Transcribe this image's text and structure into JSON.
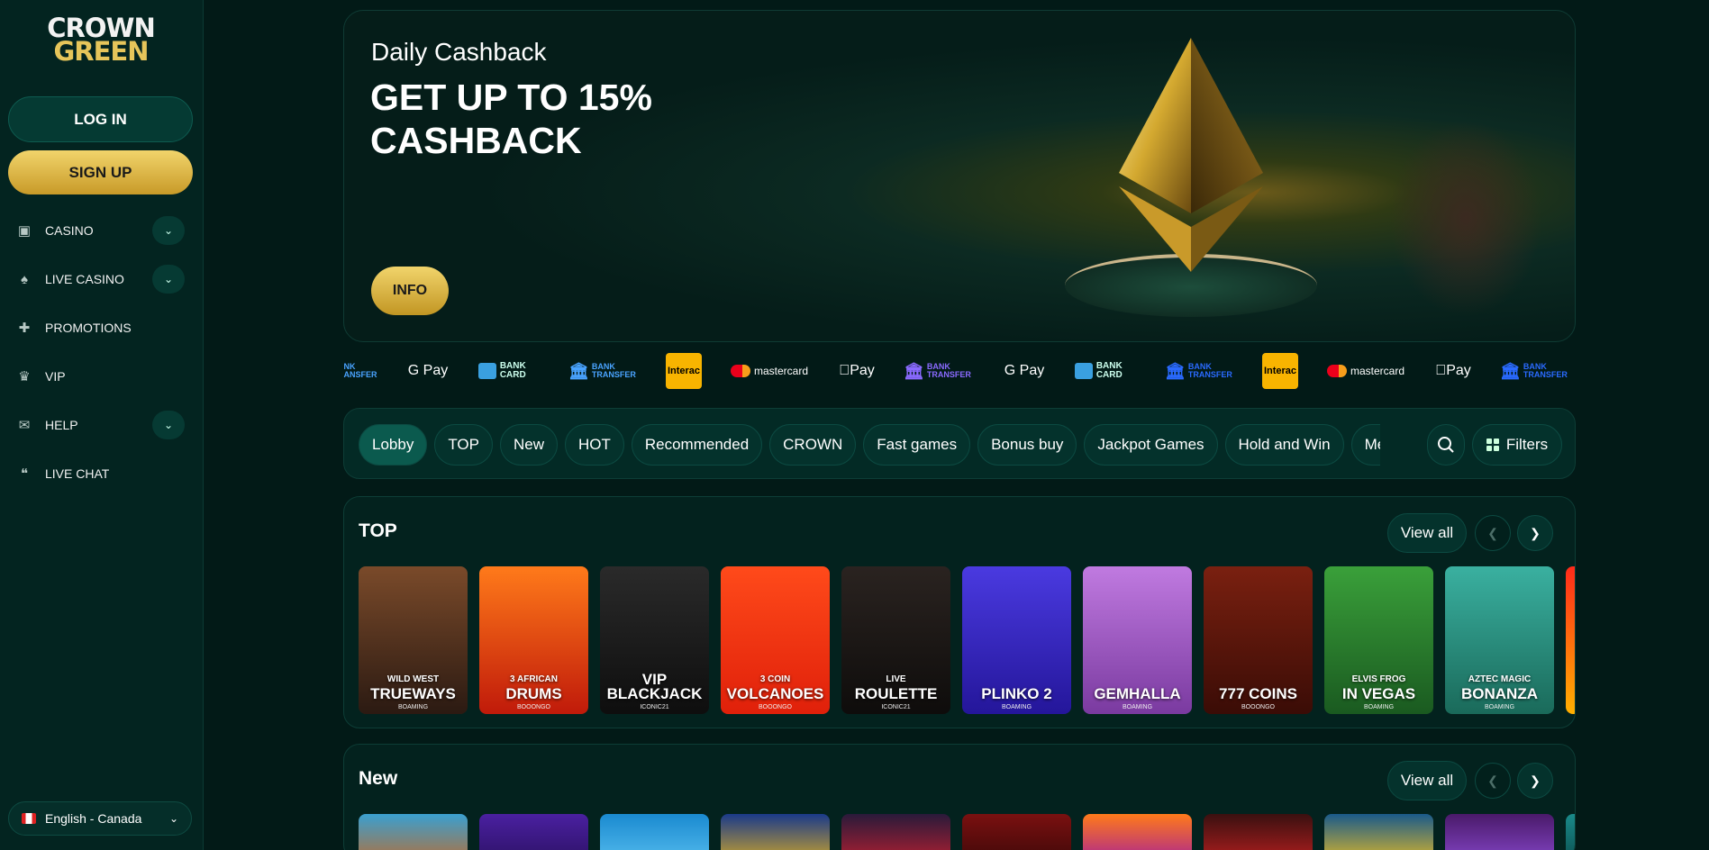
{
  "brand": {
    "line1": "CROWN",
    "line2": "GREEN"
  },
  "auth": {
    "login": "LOG IN",
    "signup": "SIGN UP"
  },
  "nav": [
    {
      "label": "CASINO",
      "icon": "casino-icon",
      "has_chevron": true
    },
    {
      "label": "LIVE CASINO",
      "icon": "spade-icon",
      "has_chevron": true
    },
    {
      "label": "PROMOTIONS",
      "icon": "gift-icon",
      "has_chevron": false
    },
    {
      "label": "VIP",
      "icon": "crown-icon",
      "has_chevron": false
    },
    {
      "label": "HELP",
      "icon": "mail-icon",
      "has_chevron": true
    },
    {
      "label": "LIVE CHAT",
      "icon": "chat-icon",
      "has_chevron": false
    }
  ],
  "language": {
    "label": "English - Canada",
    "flag": "canada-flag-icon"
  },
  "hero": {
    "subtitle": "Daily Cashback",
    "title": "GET UP TO 15% CASHBACK",
    "button": "INFO"
  },
  "payments": [
    {
      "type": "banktransfer",
      "label": "BANK TRANSFER",
      "partial": true,
      "visible": "NK\nANSFER"
    },
    {
      "type": "gpay",
      "label": "G Pay"
    },
    {
      "type": "bankcard",
      "label": "BANK CARD"
    },
    {
      "type": "banktransfer",
      "label": "BANK TRANSFER"
    },
    {
      "type": "interac",
      "label": "Interac"
    },
    {
      "type": "mastercard",
      "label": "mastercard"
    },
    {
      "type": "applepay",
      "label": "Pay"
    },
    {
      "type": "banktransfer",
      "label": "BANK TRANSFER"
    },
    {
      "type": "gpay",
      "label": "G Pay"
    },
    {
      "type": "bankcard",
      "label": "BANK CARD"
    },
    {
      "type": "banktransfer",
      "label": "BANK TRANSFER"
    },
    {
      "type": "interac",
      "label": "Interac"
    },
    {
      "type": "mastercard",
      "label": "mastercard"
    },
    {
      "type": "applepay",
      "label": "Pay"
    },
    {
      "type": "banktransfer",
      "label": "BANK TRANSFER"
    }
  ],
  "categories": {
    "chips": [
      "Lobby",
      "TOP",
      "New",
      "HOT",
      "Recommended",
      "CROWN",
      "Fast games",
      "Bonus buy",
      "Jackpot Games",
      "Hold and Win",
      "Megaways"
    ],
    "active": "Lobby",
    "filters_label": "Filters"
  },
  "sections": {
    "top": {
      "title": "TOP",
      "view_all": "View all",
      "games": [
        {
          "small": "WILD WEST",
          "big": "TRUEWAYS",
          "provider": "BOAMING",
          "colors": [
            "#7a4a2a",
            "#2b1a12"
          ]
        },
        {
          "small": "3 AFRICAN",
          "big": "DRUMS",
          "provider": "BOOONGO",
          "colors": [
            "#ff7a1a",
            "#c01a0a"
          ]
        },
        {
          "small": "",
          "big": "BLACKJACK",
          "top": "VIP",
          "provider": "ICONIC21",
          "colors": [
            "#2a2a2a",
            "#0e0e0e"
          ]
        },
        {
          "small": "3 COIN",
          "big": "VOLCANOES",
          "provider": "BOOONGO",
          "colors": [
            "#ff4a1a",
            "#e0200a"
          ]
        },
        {
          "small": "LIVE",
          "big": "ROULETTE",
          "provider": "ICONIC21",
          "colors": [
            "#2a2320",
            "#0e0c0b"
          ]
        },
        {
          "small": "",
          "big": "PLINKO 2",
          "provider": "BOAMING",
          "colors": [
            "#4a3ae0",
            "#24169a"
          ]
        },
        {
          "small": "",
          "big": "GEMHALLA",
          "provider": "BOAMING",
          "colors": [
            "#c07ae0",
            "#7a3aa0"
          ]
        },
        {
          "small": "",
          "big": "777 COINS",
          "provider": "BOOONGO",
          "colors": [
            "#7a2010",
            "#3a0c06"
          ]
        },
        {
          "small": "ELVIS FROG",
          "big": "IN VEGAS",
          "provider": "BOAMING",
          "colors": [
            "#3aa03a",
            "#1a5a20"
          ]
        },
        {
          "small": "AZTEC MAGIC",
          "big": "BONANZA",
          "provider": "BOAMING",
          "colors": [
            "#3ab0a0",
            "#1a6a5a"
          ]
        },
        {
          "small": "",
          "big": "",
          "provider": "",
          "colors": [
            "#ff2a1a",
            "#ffb000"
          ]
        }
      ]
    },
    "new": {
      "title": "New",
      "view_all": "View all",
      "games": [
        {
          "colors": [
            "#3aa0d0",
            "#c06a2a"
          ]
        },
        {
          "colors": [
            "#4a20a0",
            "#2a1060"
          ]
        },
        {
          "colors": [
            "#1a8ad0",
            "#5ac0f0"
          ]
        },
        {
          "colors": [
            "#1a3a8a",
            "#e0b020"
          ]
        },
        {
          "colors": [
            "#2a1a3a",
            "#c02030"
          ]
        },
        {
          "colors": [
            "#7a1010",
            "#3a0808"
          ]
        },
        {
          "colors": [
            "#ff7a1a",
            "#a01aa0"
          ]
        },
        {
          "colors": [
            "#3a1010",
            "#c02020"
          ]
        },
        {
          "colors": [
            "#1a5a8a",
            "#f0c020"
          ]
        },
        {
          "colors": [
            "#4a1a6a",
            "#8a4ad0"
          ]
        },
        {
          "colors": [
            "#1a8a8a",
            "#0a4a4a"
          ]
        }
      ]
    }
  }
}
